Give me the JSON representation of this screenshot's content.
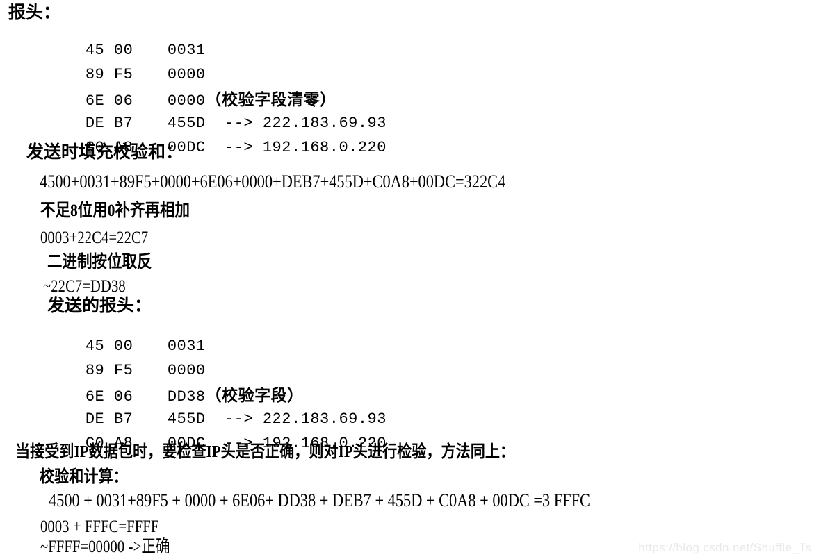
{
  "document": {
    "background_color": "#ffffff",
    "text_color": "#000000",
    "watermark": "https://blog.csdn.net/Shuffle_Ts",
    "watermark_color": "#e9e9e9"
  },
  "section_original_header": {
    "title": "报头：",
    "rows": [
      {
        "bytes": "45 00",
        "value": "0031",
        "note": ""
      },
      {
        "bytes": "89 F5",
        "value": "0000",
        "note": ""
      },
      {
        "bytes": "6E 06",
        "value": "0000",
        "note": "（校验字段清零）"
      },
      {
        "bytes": "DE B7",
        "value": "455D  --> 222.183.69.93",
        "note": ""
      },
      {
        "bytes": "C0 A8",
        "value": "00DC  --> 192.168.0.220",
        "note": ""
      }
    ]
  },
  "section_send_checksum": {
    "title": "发送时填充校验和：",
    "sum_line": "4500+0031+89F5+0000+6E06+0000+DEB7+455D+C0A8+00DC=322C4",
    "carry_note": "不足8位用0补齐再相加",
    "carry_line": "0003+22C4=22C7",
    "invert_note": "二进制按位取反",
    "invert_line": "~22C7=DD38"
  },
  "section_sent_header": {
    "title": "发送的报头：",
    "rows": [
      {
        "bytes": "45 00",
        "value": "0031",
        "note": ""
      },
      {
        "bytes": "89 F5",
        "value": "0000",
        "note": ""
      },
      {
        "bytes": "6E 06",
        "value": "DD38",
        "note": "（校验字段）"
      },
      {
        "bytes": "DE B7",
        "value": "455D  --> 222.183.69.93",
        "note": ""
      },
      {
        "bytes": "C0 A8",
        "value": "00DC  --> 192.168.0.220",
        "note": ""
      }
    ]
  },
  "section_receive_verify": {
    "intro": "当接受到IP数据包时，要检查IP头是否正确，则对IP头进行检验，方法同上：",
    "title": "校验和计算：",
    "sum_line": "4500 + 0031+89F5 + 0000 + 6E06+ DD38 + DEB7 + 455D + C0A8 + 00DC =3 FFFC",
    "carry_line": "0003 + FFFC=FFFF",
    "result_line": "~FFFF=00000 ->正确"
  }
}
